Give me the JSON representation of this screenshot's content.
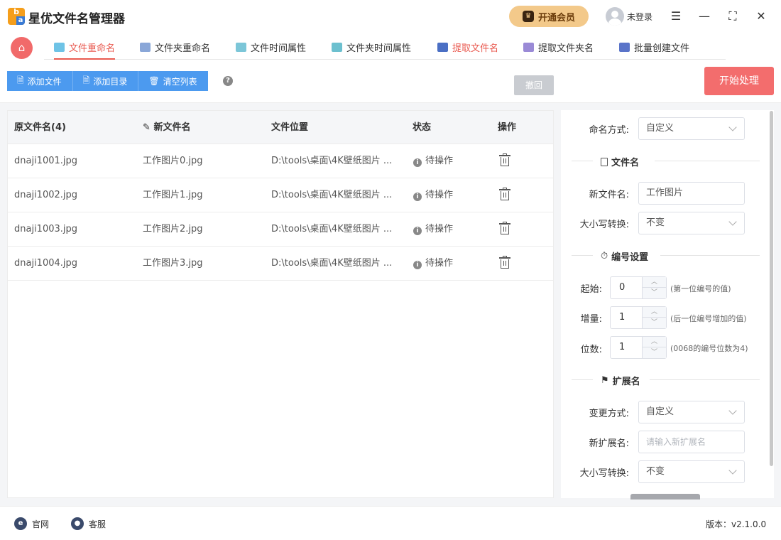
{
  "app": {
    "title": "星优文件名管理器"
  },
  "header": {
    "vip_label": "开通会员",
    "login_label": "未登录"
  },
  "tabs": [
    {
      "label": "文件重命名"
    },
    {
      "label": "文件夹重命名"
    },
    {
      "label": "文件时间属性"
    },
    {
      "label": "文件夹时间属性"
    },
    {
      "label": "提取文件名"
    },
    {
      "label": "提取文件夹名"
    },
    {
      "label": "批量创建文件"
    }
  ],
  "toolbar": {
    "add_file": "添加文件",
    "add_dir": "添加目录",
    "clear_list": "清空列表",
    "undo": "撤回",
    "start": "开始处理"
  },
  "table": {
    "columns": [
      "原文件名(4)",
      "新文件名",
      "文件位置",
      "状态",
      "操作"
    ],
    "rows": [
      {
        "original": "dnaji1001.jpg",
        "new": "工作图片0.jpg",
        "location": "D:\\tools\\桌面\\4K壁纸图片 ...",
        "status": "待操作"
      },
      {
        "original": "dnaji1002.jpg",
        "new": "工作图片1.jpg",
        "location": "D:\\tools\\桌面\\4K壁纸图片 ...",
        "status": "待操作"
      },
      {
        "original": "dnaji1003.jpg",
        "new": "工作图片2.jpg",
        "location": "D:\\tools\\桌面\\4K壁纸图片 ...",
        "status": "待操作"
      },
      {
        "original": "dnaji1004.jpg",
        "new": "工作图片3.jpg",
        "location": "D:\\tools\\桌面\\4K壁纸图片 ...",
        "status": "待操作"
      }
    ]
  },
  "panel": {
    "naming_mode_label": "命名方式:",
    "naming_mode_value": "自定义",
    "section_filename": "文件名",
    "new_name_label": "新文件名:",
    "new_name_value": "工作图片",
    "case_label": "大小写转换:",
    "case_value": "不变",
    "section_number": "编号设置",
    "start_label": "起始:",
    "start_value": "0",
    "start_hint": "(第一位编号的值)",
    "step_label": "增量:",
    "step_value": "1",
    "step_hint": "(后一位编号增加的值)",
    "digits_label": "位数:",
    "digits_value": "1",
    "digits_hint": "(0068的编号位数为4)",
    "section_ext": "扩展名",
    "ext_mode_label": "变更方式:",
    "ext_mode_value": "自定义",
    "new_ext_label": "新扩展名:",
    "new_ext_placeholder": "请输入新扩展名",
    "ext_case_label": "大小写转换:",
    "ext_case_value": "不变"
  },
  "footer": {
    "website": "官网",
    "service": "客服",
    "version": "版本：v2.1.0.0"
  },
  "colors": {
    "accent_red": "#e9594f",
    "toolbar_blue": "#4c9aef",
    "start_red": "#f36d6d",
    "vip_gold": "#f3c98a"
  }
}
